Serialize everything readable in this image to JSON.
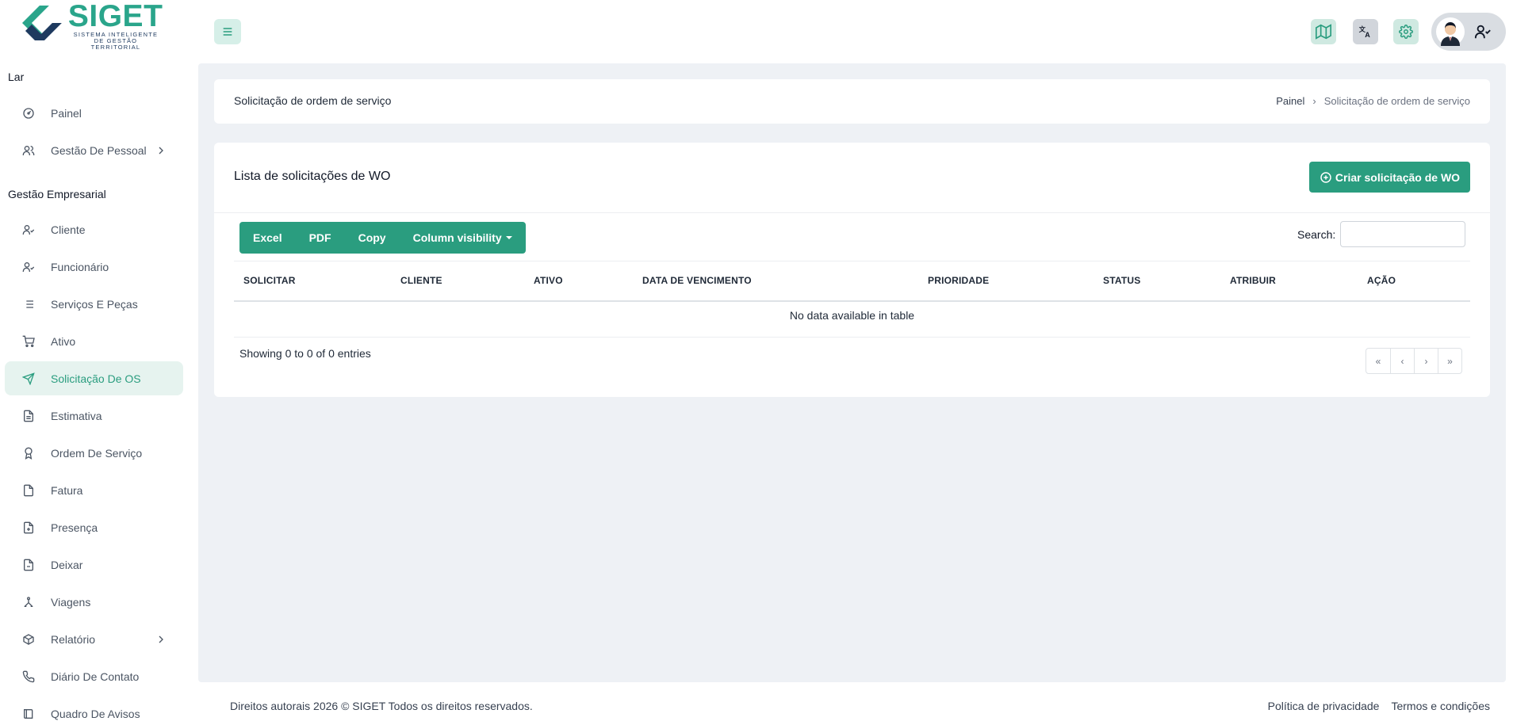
{
  "brand": {
    "name": "SIGET",
    "tagline_line1": "SISTEMA INTELIGENTE",
    "tagline_line2": "DE GESTÃO TERRITORIAL",
    "accent": "#2a9d7f",
    "dark": "#1e3a5f"
  },
  "sidebar": {
    "section1": "Lar",
    "section2": "Gestão Empresarial",
    "items": [
      {
        "label": "Painel",
        "icon": "dashboard-icon"
      },
      {
        "label": "Gestão De Pessoal",
        "icon": "users-icon"
      },
      {
        "label": "Cliente",
        "icon": "user-check-icon"
      },
      {
        "label": "Funcionário",
        "icon": "user-check-icon"
      },
      {
        "label": "Serviços E Peças",
        "icon": "list-icon"
      },
      {
        "label": "Ativo",
        "icon": "cart-icon"
      },
      {
        "label": "Solicitação De OS",
        "icon": "send-icon"
      },
      {
        "label": "Estimativa",
        "icon": "file-text-icon"
      },
      {
        "label": "Ordem De Serviço",
        "icon": "award-icon"
      },
      {
        "label": "Fatura",
        "icon": "file-icon"
      },
      {
        "label": "Presença",
        "icon": "file-plus-icon"
      },
      {
        "label": "Deixar",
        "icon": "file-minus-icon"
      },
      {
        "label": "Viagens",
        "icon": "travel-icon"
      },
      {
        "label": "Relatório",
        "icon": "box-icon"
      },
      {
        "label": "Diário De Contato",
        "icon": "phone-icon"
      },
      {
        "label": "Quadro De Avisos",
        "icon": "book-icon"
      }
    ]
  },
  "header": {
    "breadcrumb_title": "Solicitação de ordem de serviço",
    "breadcrumb_home": "Painel",
    "breadcrumb_current": "Solicitação de ordem de serviço"
  },
  "list": {
    "title": "Lista de solicitações de WO",
    "create_label": "Criar solicitação de WO",
    "export_buttons": [
      "Excel",
      "PDF",
      "Copy",
      "Column visibility"
    ],
    "search_label": "Search:",
    "search_value": "",
    "columns": [
      "SOLICITAR",
      "CLIENTE",
      "ATIVO",
      "DATA DE VENCIMENTO",
      "PRIORIDADE",
      "STATUS",
      "ATRIBUIR",
      "AÇÃO"
    ],
    "empty_message": "No data available in table",
    "entries_info": "Showing 0 to 0 of 0 entries",
    "pager": [
      "«",
      "‹",
      "›",
      "»"
    ]
  },
  "footer": {
    "copyright": "Direitos autorais 2026 © SIGET Todos os direitos reservados.",
    "privacy": "Política de privacidade",
    "terms": "Termos e condições"
  }
}
